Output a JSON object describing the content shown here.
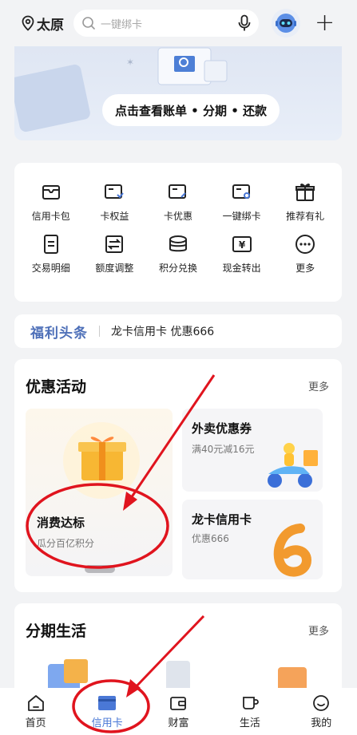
{
  "topbar": {
    "location": "太原",
    "search_placeholder": "一键绑卡"
  },
  "banner": {
    "pill_text": "点击查看账单 • 分期 • 还款"
  },
  "services": {
    "row1": [
      {
        "label": "信用卡包",
        "icon": "card-wallet-icon"
      },
      {
        "label": "卡权益",
        "icon": "card-benefit-icon"
      },
      {
        "label": "卡优惠",
        "icon": "card-discount-icon"
      },
      {
        "label": "一键绑卡",
        "icon": "bind-card-icon"
      },
      {
        "label": "推荐有礼",
        "icon": "gift-icon"
      }
    ],
    "row2": [
      {
        "label": "交易明细",
        "icon": "transaction-detail-icon"
      },
      {
        "label": "额度调整",
        "icon": "limit-adjust-icon"
      },
      {
        "label": "积分兑换",
        "icon": "points-exchange-icon"
      },
      {
        "label": "现金转出",
        "icon": "cash-out-icon"
      },
      {
        "label": "更多",
        "icon": "more-icon"
      }
    ]
  },
  "news": {
    "tag": "福利头条",
    "text": "龙卡信用卡 优惠666"
  },
  "promo": {
    "title": "优惠活动",
    "more": "更多",
    "left_title": "消费达标",
    "left_sub": "瓜分百亿积分",
    "r1_title": "外卖优惠券",
    "r1_sub": "满40元减16元",
    "r2_title": "龙卡信用卡",
    "r2_sub": "优惠666"
  },
  "installment": {
    "title": "分期生活",
    "more": "更多"
  },
  "tabs": [
    {
      "label": "首页",
      "icon": "home-icon"
    },
    {
      "label": "信用卡",
      "icon": "credit-card-icon"
    },
    {
      "label": "财富",
      "icon": "wallet-icon"
    },
    {
      "label": "生活",
      "icon": "coffee-cup-icon"
    },
    {
      "label": "我的",
      "icon": "smile-icon"
    }
  ],
  "colors": {
    "accent": "#4a78d6",
    "annotation": "#e0141e",
    "background": "#f2f3f5"
  }
}
